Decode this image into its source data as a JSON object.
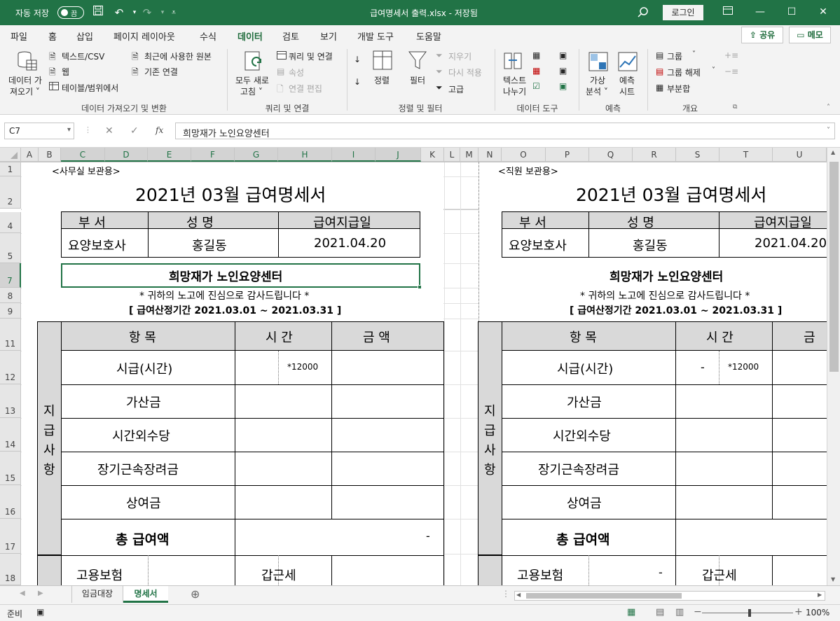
{
  "titlebar": {
    "autosave_label": "자동 저장",
    "autosave_state": "끔",
    "document_title": "급여명세서 출력.xlsx  -  저장됨",
    "login_label": "로그인"
  },
  "menu": {
    "tabs": [
      "파일",
      "홈",
      "삽입",
      "페이지 레이아웃",
      "수식",
      "데이터",
      "검토",
      "보기",
      "개발 도구",
      "도움말"
    ],
    "active_tab": "데이터",
    "share_label": "공유",
    "memo_label": "메모"
  },
  "ribbon": {
    "get_data": {
      "button1": "데이터 가",
      "button2": "져오기 ˅",
      "text_csv": "텍스트/CSV",
      "web": "웹",
      "table_range": "테이블/범위에서",
      "recent_sources": "최근에 사용한 원본",
      "existing_connections": "기존 연결",
      "group_label": "데이터 가져오기 및 변환"
    },
    "queries": {
      "refresh_all_1": "모두 새로",
      "refresh_all_2": "고침 ˅",
      "queries_connections": "쿼리 및 연결",
      "properties": "속성",
      "edit_links": "연결 편집",
      "group_label": "쿼리 및 연결"
    },
    "sort_filter": {
      "sort": "정렬",
      "filter": "필터",
      "clear": "지우기",
      "reapply": "다시 적용",
      "advanced": "고급",
      "group_label": "정렬 및 필터"
    },
    "data_tools": {
      "text_to_columns_1": "텍스트",
      "text_to_columns_2": "나누기",
      "group_label": "데이터 도구"
    },
    "forecast": {
      "what_if_1": "가상",
      "what_if_2": "분석 ˅",
      "forecast_sheet_1": "예측",
      "forecast_sheet_2": "시트",
      "group_label": "예측"
    },
    "outline": {
      "group": "그룹",
      "ungroup": "그룹 해제",
      "subtotal": "부분합",
      "group_label": "개요"
    }
  },
  "formula_bar": {
    "name_box": "C7",
    "fx": "fx",
    "formula": "희망재가 노인요양센터"
  },
  "columns": [
    "A",
    "B",
    "C",
    "D",
    "E",
    "F",
    "G",
    "H",
    "I",
    "J",
    "K",
    "L",
    "M",
    "N",
    "O",
    "P",
    "Q",
    "R",
    "S",
    "T",
    "U"
  ],
  "rows": [
    "1",
    "2",
    "4",
    "5",
    "7",
    "8",
    "9",
    "11",
    "12",
    "13",
    "14",
    "15",
    "16",
    "17",
    "18"
  ],
  "sheet_left": {
    "copy_label": "<사무실 보관용>",
    "title": "2021년 03월 급여명세서",
    "hdr_dept": "부    서",
    "hdr_name": "성    명",
    "hdr_paydate": "급여지급일",
    "dept": "요양보호사",
    "name": "홍길동",
    "paydate": "2021.04.20",
    "company": "희망재가 노인요양센터",
    "thanks": "* 귀하의 노고에 진심으로 감사드립니다 *",
    "period": "[ 급여산정기간 2021.03.01 ~ 2021.03.31 ]",
    "section": [
      "지",
      "급",
      "사",
      "항"
    ],
    "col_item": "항  목",
    "col_time": "시  간",
    "col_amount": "금    액",
    "items": [
      "시급(시간)",
      "가산금",
      "시간외수당",
      "장기근속장려금",
      "상여금"
    ],
    "hourly_rate": "*12000",
    "total_label": "총 급여액",
    "total_value": "-",
    "ins_label": "고용보험",
    "tax_label": "갑근세"
  },
  "sheet_right": {
    "copy_label": "<직원 보관용>",
    "title": "2021년 03월 급여명세서",
    "hdr_dept": "부    서",
    "hdr_name": "성    명",
    "hdr_paydate": "급여지급일",
    "dept": "요양보호사",
    "name": "홍길동",
    "paydate": "2021.04.20",
    "company": "희망재가 노인요양센터",
    "thanks": "* 귀하의 노고에 진심으로 감사드립니다 *",
    "period": "[ 급여산정기간 2021.03.01 ~ 2021.03.31 ]",
    "section": [
      "지",
      "급",
      "사",
      "항"
    ],
    "col_item": "항  목",
    "col_time": "시  간",
    "col_amount": "금",
    "items": [
      "시급(시간)",
      "가산금",
      "시간외수당",
      "장기근속장려금",
      "상여금"
    ],
    "hours_value": "-",
    "hourly_rate": "*12000",
    "total_label": "총 급여액",
    "ins_label": "고용보험",
    "ins_value": "-",
    "tax_label": "갑근세"
  },
  "sheets": [
    "임금대장",
    "명세서"
  ],
  "active_sheet": "명세서",
  "status": {
    "ready": "준비",
    "zoom": "100%"
  },
  "colors": {
    "excel_green": "#217346",
    "header_fill": "#d9d9d9"
  }
}
